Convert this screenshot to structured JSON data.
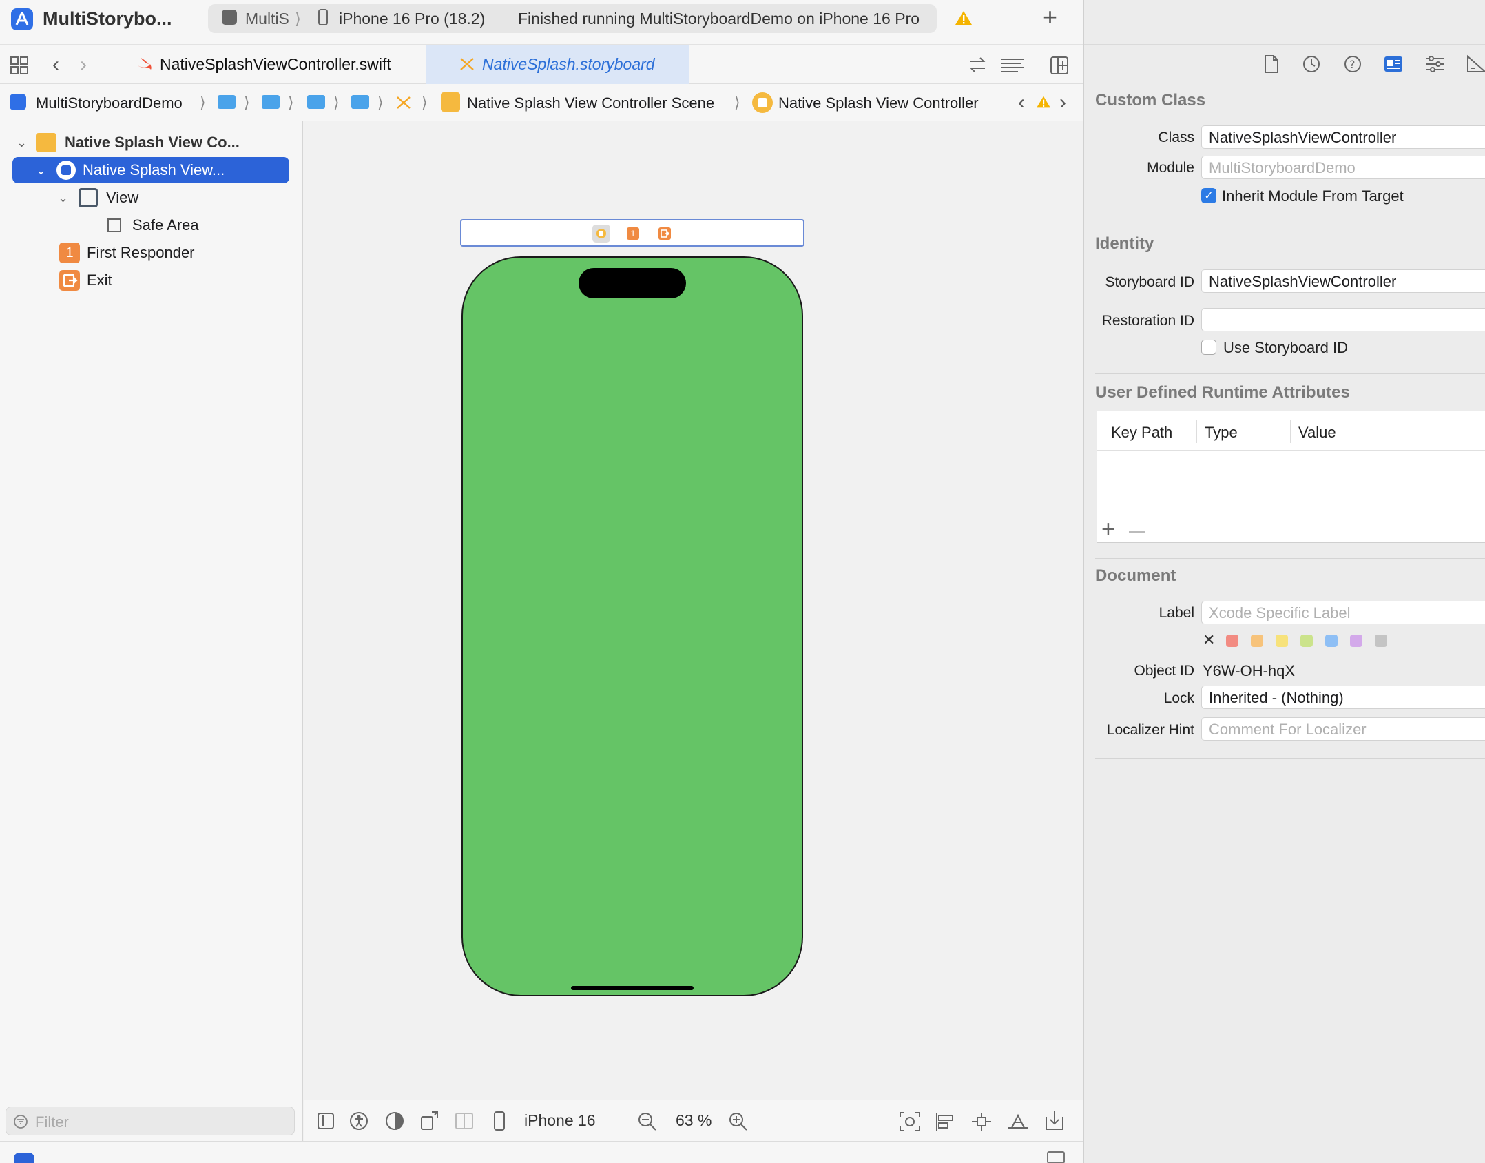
{
  "toolbar": {
    "app_title": "MultiStorybo...",
    "scheme_short": "MultiS",
    "destination": "iPhone 16 Pro (18.2)",
    "status": "Finished running MultiStoryboardDemo on iPhone 16 Pro"
  },
  "tabs": {
    "swift_file": "NativeSplashViewController.swift",
    "storyboard_file": "NativeSplash.storyboard"
  },
  "jumpbar": {
    "project": "MultiStoryboardDemo",
    "scene": "Native Splash View Controller Scene",
    "controller": "Native Splash View Controller"
  },
  "outline": {
    "scene": "Native Splash View Co...",
    "controller": "Native Splash View...",
    "view": "View",
    "safe_area": "Safe Area",
    "first_responder": "First Responder",
    "first_responder_badge": "1",
    "exit": "Exit"
  },
  "navigator": {
    "filter_placeholder": "Filter"
  },
  "canvas": {
    "scene_badge": "1",
    "device": "iPhone 16",
    "zoom": "63 %",
    "view_background": "#65c466"
  },
  "inspector": {
    "custom_class": {
      "title": "Custom Class",
      "class_label": "Class",
      "class_value": "NativeSplashViewController",
      "module_label": "Module",
      "module_placeholder": "MultiStoryboardDemo",
      "inherit_label": "Inherit Module From Target",
      "inherit_checked": true
    },
    "identity": {
      "title": "Identity",
      "storyboard_id_label": "Storyboard ID",
      "storyboard_id_value": "NativeSplashViewController",
      "restoration_id_label": "Restoration ID",
      "restoration_id_value": "",
      "use_storyboard_id_label": "Use Storyboard ID",
      "use_storyboard_id_checked": false
    },
    "runtime_attributes": {
      "title": "User Defined Runtime Attributes",
      "columns": [
        "Key Path",
        "Type",
        "Value"
      ],
      "rows": []
    },
    "document": {
      "title": "Document",
      "label_label": "Label",
      "label_placeholder": "Xcode Specific Label",
      "object_id_label": "Object ID",
      "object_id_value": "Y6W-OH-hqX",
      "lock_label": "Lock",
      "lock_value": "Inherited - (Nothing)",
      "localizer_label": "Localizer Hint",
      "localizer_placeholder": "Comment For Localizer",
      "label_colors": [
        "#f28b82",
        "#f7c37b",
        "#f7e27b",
        "#cbe38b",
        "#8ebff5",
        "#d3a9ea",
        "#c4c4c4"
      ]
    }
  }
}
